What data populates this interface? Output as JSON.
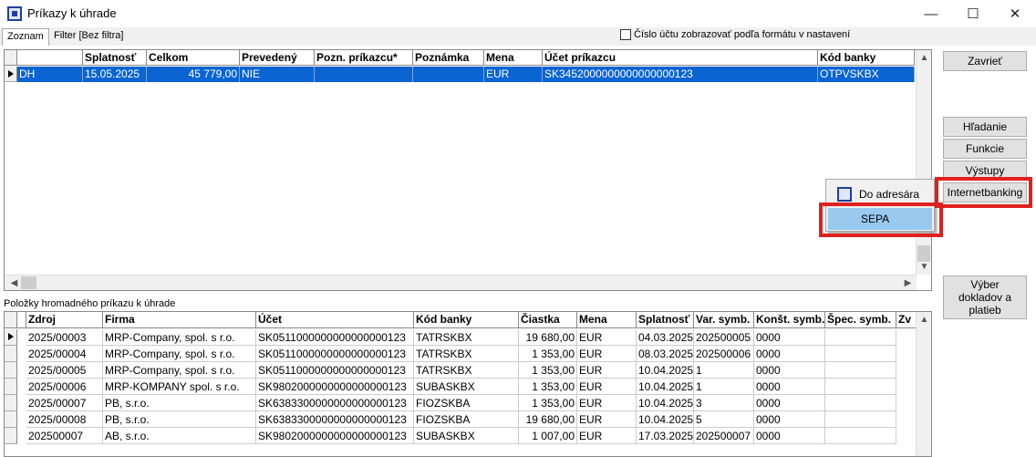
{
  "window": {
    "title": "Príkazy k úhrade",
    "minimize": "—",
    "maximize": "☐",
    "close": "✕"
  },
  "tabs": [
    {
      "label": "Zoznam"
    },
    {
      "label": "Filter [Bez filtra]"
    }
  ],
  "account_format_checkbox": {
    "label": "Číslo účtu zobrazovať podľa formátu v nastavení",
    "checked": false
  },
  "orders_table": {
    "columns": [
      "",
      "Splatnosť",
      "Celkom",
      "Prevedený",
      "Pozn. príkazcu*",
      "Poznámka",
      "Mena",
      "Účet príkazcu",
      "Kód banky"
    ],
    "rows": [
      [
        "DH",
        "15.05.2025",
        "45 779,00",
        "NIE",
        "",
        "",
        "EUR",
        "SK3452000000000000000123",
        "OTPVSKBX"
      ]
    ]
  },
  "buttons": {
    "close": "Zavrieť",
    "search": "Hľadanie",
    "functions": "Funkcie",
    "outputs": "Výstupy",
    "internetbanking": "Internetbanking",
    "select_documents": "Výber dokladov a platieb"
  },
  "dropdown_menu": {
    "items": [
      {
        "label": "Do adresára",
        "icon": "address-book-icon"
      },
      {
        "label": "SEPA",
        "selected": true
      }
    ]
  },
  "items_section_label": "Položky hromadného príkazu k úhrade",
  "items_table": {
    "columns": [
      "",
      "Zdroj",
      "Firma",
      "Účet",
      "Kód banky",
      "Čiastka",
      "Mena",
      "Splatnosť",
      "Var. symb.",
      "Konšt. symb.",
      "Špec. symb.",
      "Zv"
    ],
    "rows": [
      [
        "2025/00003",
        "MRP-Company, spol. s r.o.",
        "SK0511000000000000000123",
        "TATRSKBX",
        "19 680,00",
        "EUR",
        "04.03.2025",
        "202500005",
        "0000",
        ""
      ],
      [
        "2025/00004",
        "MRP-Company, spol. s r.o.",
        "SK0511000000000000000123",
        "TATRSKBX",
        "1 353,00",
        "EUR",
        "08.03.2025",
        "202500006",
        "0000",
        ""
      ],
      [
        "2025/00005",
        "MRP-Company, spol. s r.o.",
        "SK0511000000000000000123",
        "TATRSKBX",
        "1 353,00",
        "EUR",
        "10.04.2025",
        "1",
        "0000",
        ""
      ],
      [
        "2025/00006",
        "MRP-KOMPANY spol. s r.o.",
        "SK9802000000000000000123",
        "SUBASKBX",
        "1 353,00",
        "EUR",
        "10.04.2025",
        "1",
        "0000",
        ""
      ],
      [
        "2025/00007",
        "PB, s.r.o.",
        "SK6383300000000000000123",
        "FIOZSKBA",
        "1 353,00",
        "EUR",
        "10.04.2025",
        "3",
        "0000",
        ""
      ],
      [
        "2025/00008",
        "PB, s.r.o.",
        "SK6383300000000000000123",
        "FIOZSKBA",
        "19 680,00",
        "EUR",
        "10.04.2025",
        "5",
        "0000",
        ""
      ],
      [
        "202500007",
        "AB, s.r.o.",
        "SK9802000000000000000123",
        "SUBASKBX",
        "1 007,00",
        "EUR",
        "17.03.2025",
        "202500007",
        "0000",
        ""
      ]
    ]
  },
  "colors": {
    "selection": "#0a64d2",
    "highlight_box": "#e02020",
    "menu_selected": "#99c9ef"
  }
}
